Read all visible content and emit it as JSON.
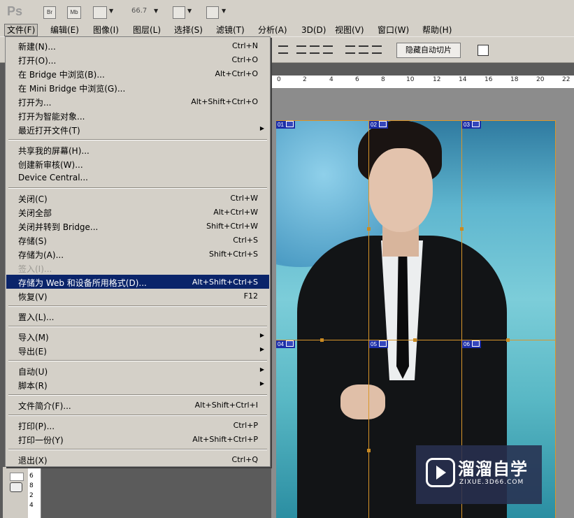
{
  "app": {
    "logo": "Ps",
    "bridge_btn": "Br",
    "minibridge_btn": "Mb",
    "zoom_value": "66.7"
  },
  "menubar": [
    {
      "label": "文件(F)",
      "active": true
    },
    {
      "label": "编辑(E)"
    },
    {
      "label": "图像(I)"
    },
    {
      "label": "图层(L)"
    },
    {
      "label": "选择(S)"
    },
    {
      "label": "滤镜(T)"
    },
    {
      "label": "分析(A)"
    },
    {
      "label": "3D(D)"
    },
    {
      "label": "视图(V)"
    },
    {
      "label": "窗口(W)"
    },
    {
      "label": "帮助(H)"
    }
  ],
  "options_bar": {
    "hide_auto_slices": "隐藏自动切片"
  },
  "ruler": {
    "h_ticks": [
      "0",
      "2",
      "4",
      "6",
      "8",
      "10",
      "12",
      "14",
      "16",
      "18",
      "20",
      "22"
    ],
    "v_ticks": [
      "6",
      "8",
      "2",
      "4"
    ]
  },
  "slices": [
    "01",
    "02",
    "03",
    "04",
    "05",
    "06"
  ],
  "watermark": {
    "title": "溜溜自学",
    "subtitle": "ZIXUE.3D66.COM"
  },
  "file_menu": [
    {
      "label": "新建(N)...",
      "shortcut": "Ctrl+N"
    },
    {
      "label": "打开(O)...",
      "shortcut": "Ctrl+O"
    },
    {
      "label": "在 Bridge 中浏览(B)...",
      "shortcut": "Alt+Ctrl+O"
    },
    {
      "label": "在 Mini Bridge 中浏览(G)...",
      "shortcut": ""
    },
    {
      "label": "打开为...",
      "shortcut": "Alt+Shift+Ctrl+O"
    },
    {
      "label": "打开为智能对象...",
      "shortcut": ""
    },
    {
      "label": "最近打开文件(T)",
      "shortcut": "",
      "submenu": true
    },
    {
      "separator": true
    },
    {
      "label": "共享我的屏幕(H)...",
      "shortcut": ""
    },
    {
      "label": "创建新审核(W)...",
      "shortcut": ""
    },
    {
      "label": "Device Central...",
      "shortcut": ""
    },
    {
      "separator": true
    },
    {
      "label": "关闭(C)",
      "shortcut": "Ctrl+W"
    },
    {
      "label": "关闭全部",
      "shortcut": "Alt+Ctrl+W"
    },
    {
      "label": "关闭并转到 Bridge...",
      "shortcut": "Shift+Ctrl+W"
    },
    {
      "label": "存储(S)",
      "shortcut": "Ctrl+S"
    },
    {
      "label": "存储为(A)...",
      "shortcut": "Shift+Ctrl+S"
    },
    {
      "label": "签入(I)...",
      "shortcut": "",
      "disabled": true
    },
    {
      "label": "存储为 Web 和设备所用格式(D)...",
      "shortcut": "Alt+Shift+Ctrl+S",
      "selected": true
    },
    {
      "label": "恢复(V)",
      "shortcut": "F12"
    },
    {
      "separator": true
    },
    {
      "label": "置入(L)...",
      "shortcut": ""
    },
    {
      "separator": true
    },
    {
      "label": "导入(M)",
      "shortcut": "",
      "submenu": true
    },
    {
      "label": "导出(E)",
      "shortcut": "",
      "submenu": true
    },
    {
      "separator": true
    },
    {
      "label": "自动(U)",
      "shortcut": "",
      "submenu": true
    },
    {
      "label": "脚本(R)",
      "shortcut": "",
      "submenu": true
    },
    {
      "separator": true
    },
    {
      "label": "文件简介(F)...",
      "shortcut": "Alt+Shift+Ctrl+I"
    },
    {
      "separator": true
    },
    {
      "label": "打印(P)...",
      "shortcut": "Ctrl+P"
    },
    {
      "label": "打印一份(Y)",
      "shortcut": "Alt+Shift+Ctrl+P"
    },
    {
      "separator": true
    },
    {
      "label": "退出(X)",
      "shortcut": "Ctrl+Q"
    }
  ]
}
